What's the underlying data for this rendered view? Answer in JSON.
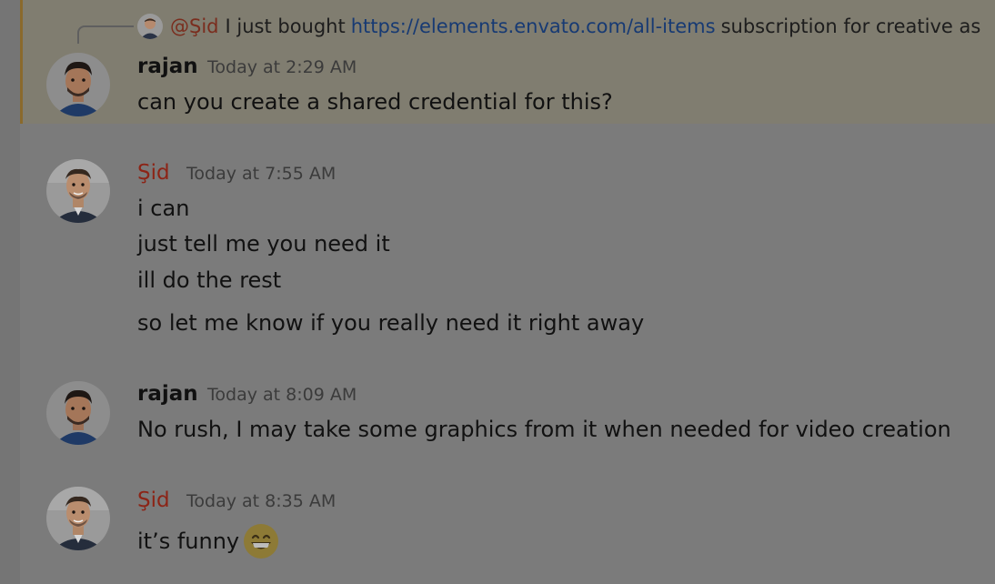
{
  "reply_preview": {
    "mention": "@Şid",
    "text_before": "I just bought",
    "link": "https://elements.envato.com/all-items",
    "text_after": "subscription for creative as"
  },
  "messages": [
    {
      "author": "rajan",
      "timestamp": "Today at 2:29 AM",
      "lines": [
        "can you create a shared credential for this?"
      ]
    },
    {
      "author": "Şid",
      "timestamp": "Today at 7:55 AM",
      "lines": [
        "i can",
        "just tell me you need it",
        "ill do the rest",
        "so let me know if you really need it right away"
      ]
    },
    {
      "author": "rajan",
      "timestamp": "Today at 8:09 AM",
      "lines": [
        "No rush, I may take some graphics from it when needed for video creation"
      ]
    },
    {
      "author": "Şid",
      "timestamp": "Today at 8:35 AM",
      "lines": [
        "it’s funny"
      ],
      "emoji": "grinning-face-with-smiling-eyes-icon"
    }
  ],
  "colors": {
    "background": "#7b7b7b",
    "highlight": "#807d70",
    "highlight_border": "#8a6a2c",
    "sid_name": "#8c2416",
    "link": "#173a73"
  }
}
